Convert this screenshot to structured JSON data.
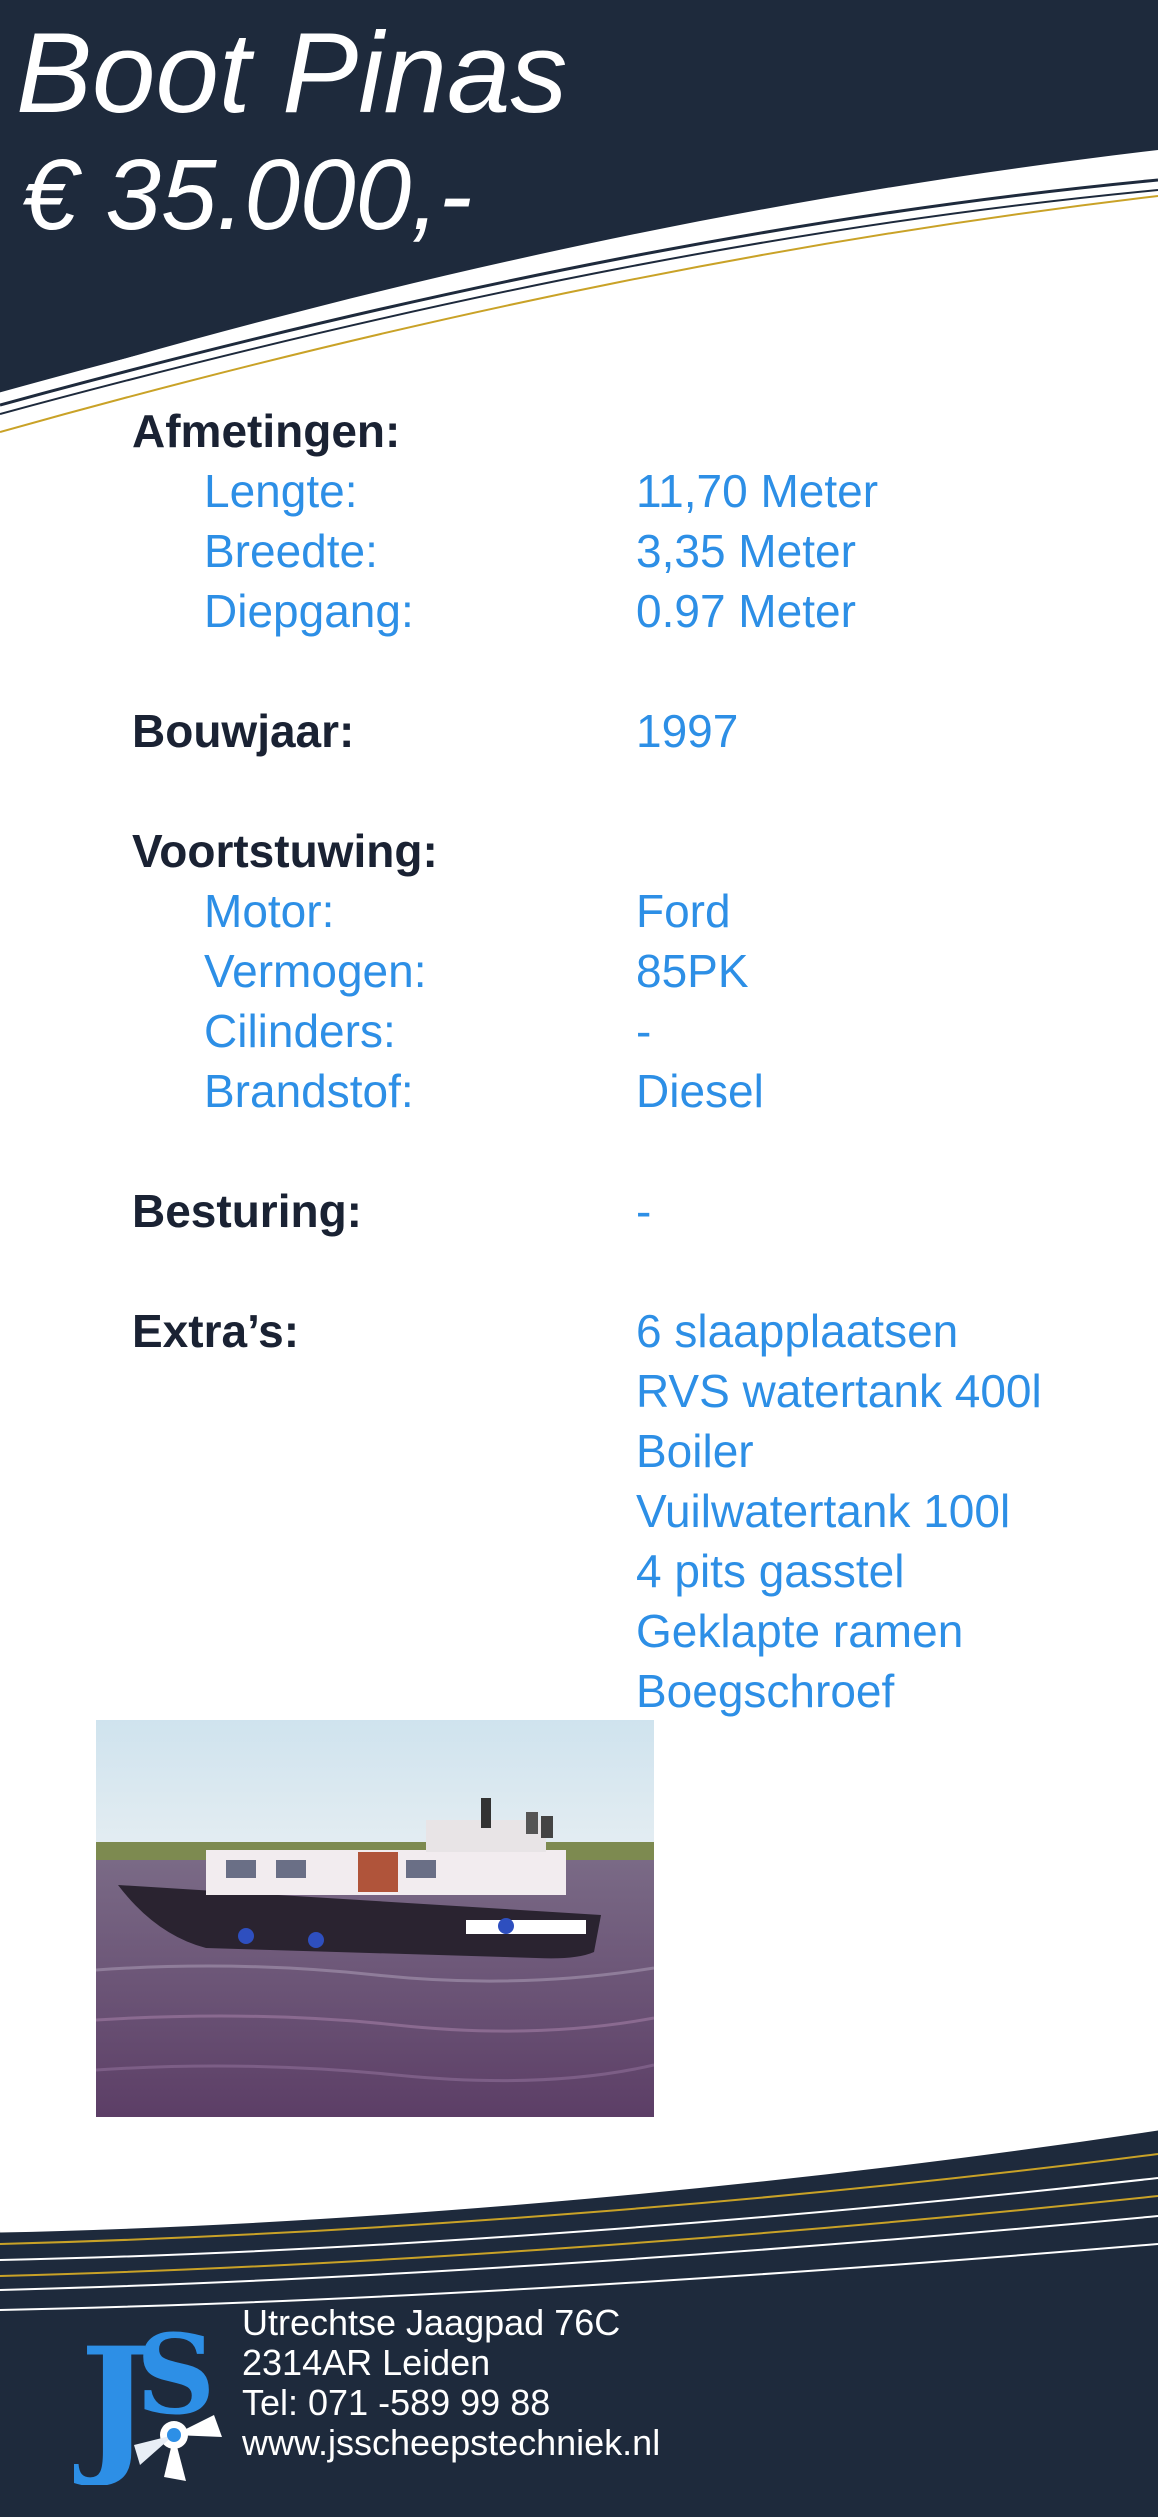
{
  "header": {
    "title": "Boot Pinas",
    "price": "€ 35.000,-"
  },
  "specs": {
    "afmetingen": {
      "label": "Afmetingen:",
      "lengte_label": "Lengte:",
      "lengte_value": "11,70 Meter",
      "breedte_label": "Breedte:",
      "breedte_value": "3,35 Meter",
      "diepgang_label": "Diepgang:",
      "diepgang_value": "0.97 Meter"
    },
    "bouwjaar": {
      "label": "Bouwjaar:",
      "value": "1997"
    },
    "voortstuwing": {
      "label": "Voortstuwing:",
      "motor_label": "Motor:",
      "motor_value": "Ford",
      "vermogen_label": "Vermogen:",
      "vermogen_value": "85PK",
      "cilinders_label": "Cilinders:",
      "cilinders_value": "-",
      "brandstof_label": "Brandstof:",
      "brandstof_value": "Diesel"
    },
    "besturing": {
      "label": "Besturing:",
      "value": "-"
    },
    "extras": {
      "label": "Extra’s:",
      "items": [
        "6 slaapplaatsen",
        "RVS watertank 400l",
        "Boiler",
        "Vuilwatertank 100l",
        "4 pits gasstel",
        "Geklapte ramen",
        "Boegschroef"
      ]
    }
  },
  "footer": {
    "logo_text": "JS",
    "address_line1": "Utrechtse Jaagpad 76C",
    "address_line2": "2314AR Leiden",
    "phone": "Tel: 071 -589 99 88",
    "website": "www.jsscheepstechniek.nl"
  },
  "colors": {
    "navy": "#1e2a3c",
    "accent_blue": "#2d8fe6",
    "gold_line": "#c9a227",
    "heading_text": "#1a2233"
  }
}
